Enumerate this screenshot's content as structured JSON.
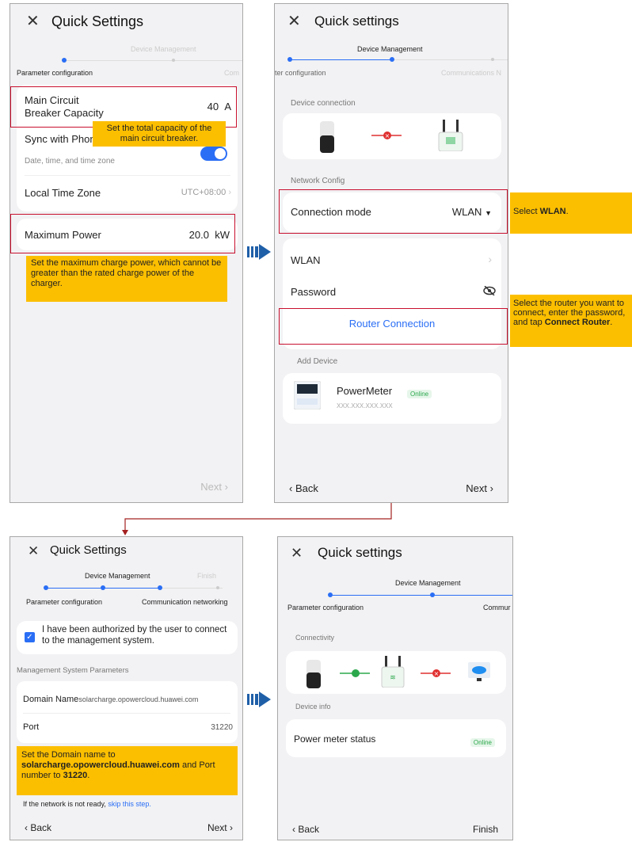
{
  "screen1": {
    "title": "Quick Settings",
    "step_mid": "Device Management",
    "step_left": "Parameter configuration",
    "step_right": "Com",
    "mccb_label_1": "Main Circuit",
    "mccb_label_2": "Breaker Capacity",
    "mccb_value": "40",
    "mccb_unit": "A",
    "tip_mccb": "Set the total capacity of the main circuit breaker.",
    "sync_label": "Sync with Phone",
    "sync_sub": "Date, time, and time zone",
    "tz_label": "Local Time Zone",
    "tz_value": "UTC+08:00",
    "maxp_label": "Maximum Power",
    "maxp_value": "20.0",
    "maxp_unit": "kW",
    "tip_maxp": "Set the maximum charge power, which cannot be greater than the rated charge power of the charger.",
    "next": "Next"
  },
  "screen2": {
    "title": "Quick settings",
    "step_mid": "Device Management",
    "step_left": "ter configuration",
    "step_right": "Communications N",
    "device_connection": "Device connection",
    "network_config": "Network Config",
    "conn_mode_label": "Connection mode",
    "conn_mode_value": "WLAN",
    "wlan_label": "WLAN",
    "password_label": "Password",
    "router_button": "Router Connection",
    "add_device": "Add Device",
    "meter_name": "PowerMeter",
    "meter_status": "Online",
    "meter_addr": "XXX.XXX.XXX.XXX",
    "back": "Back",
    "next": "Next",
    "tip_wlan_pre": "Select ",
    "tip_wlan_bold": "WLAN",
    "tip_wlan_post": ".",
    "tip_router_pre": "Select the router you want to connect, enter the password, and tap ",
    "tip_router_bold": "Connect Router",
    "tip_router_post": "."
  },
  "screen3": {
    "title": "Quick Settings",
    "step_mid": "Device Management",
    "step_finish": "Finish",
    "step_left": "Parameter configuration",
    "step_right": "Communication networking",
    "auth_text": "I have been authorized by the user to connect to the management system.",
    "mgmt_params": "Management System Parameters",
    "domain_label": "Domain Name",
    "domain_value": "solarcharge.opowercloud.huawei.com",
    "port_label": "Port",
    "port_value": "31220",
    "tip_pre": "Set the Domain name to ",
    "tip_domain": "solarcharge.opowercloud.huawei.com",
    "tip_mid": " and Port number to ",
    "tip_port": "31220",
    "tip_post": ".",
    "network_note": "If the network is not ready, ",
    "skip_link": "skip this step.",
    "back": "Back",
    "next": "Next"
  },
  "screen4": {
    "title": "Quick settings",
    "step_mid": "Device Management",
    "step_left": "Parameter configuration",
    "step_right": "Commur",
    "connectivity": "Connectivity",
    "device_info": "Device info",
    "meter_status_label": "Power meter status",
    "meter_status_value": "Online",
    "back": "Back",
    "finish": "Finish"
  },
  "icons": {
    "close": "close-icon",
    "chevron": "chevron-right-icon",
    "back": "chevron-left-icon",
    "eye": "eye-off-icon",
    "arrow": "right-arrow-icon"
  },
  "colors": {
    "accent": "#2a6ef5",
    "tip": "#fcbf00",
    "highlight": "#c8102e",
    "online": "#2ca84c"
  }
}
